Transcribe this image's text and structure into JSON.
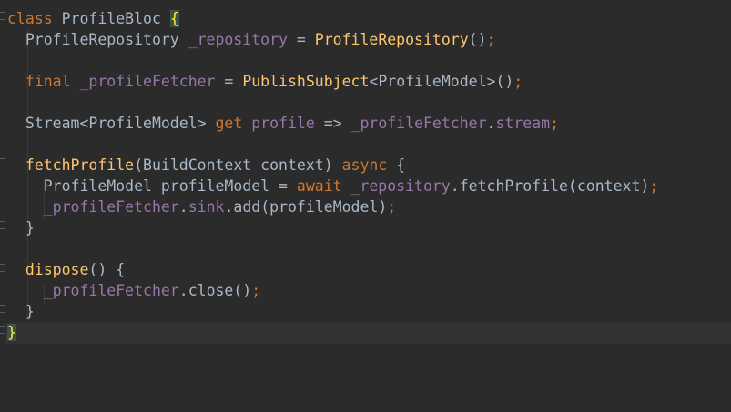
{
  "editor": {
    "lines": [
      [
        {
          "t": "class",
          "c": "kw"
        },
        {
          "t": " ProfileBloc ",
          "c": "id"
        },
        {
          "t": "{",
          "c": "brace-match"
        }
      ],
      [
        {
          "t": "  ProfileRepository ",
          "c": "id"
        },
        {
          "t": "_repository",
          "c": "fld"
        },
        {
          "t": " = ",
          "c": "id"
        },
        {
          "t": "ProfileRepository",
          "c": "fn"
        },
        {
          "t": "()",
          "c": "id"
        },
        {
          "t": ";",
          "c": "kw"
        }
      ],
      [],
      [
        {
          "t": "  ",
          "c": "id"
        },
        {
          "t": "final",
          "c": "kw"
        },
        {
          "t": " ",
          "c": "id"
        },
        {
          "t": "_profileFetcher",
          "c": "fld"
        },
        {
          "t": " = ",
          "c": "id"
        },
        {
          "t": "PublishSubject",
          "c": "fn"
        },
        {
          "t": "<ProfileModel>()",
          "c": "id"
        },
        {
          "t": ";",
          "c": "kw"
        }
      ],
      [],
      [
        {
          "t": "  Stream<ProfileModel> ",
          "c": "id"
        },
        {
          "t": "get",
          "c": "kw"
        },
        {
          "t": " ",
          "c": "id"
        },
        {
          "t": "profile",
          "c": "fld"
        },
        {
          "t": " => ",
          "c": "id"
        },
        {
          "t": "_profileFetcher",
          "c": "fld"
        },
        {
          "t": ".",
          "c": "id"
        },
        {
          "t": "stream",
          "c": "fld"
        },
        {
          "t": ";",
          "c": "kw"
        }
      ],
      [],
      [
        {
          "t": "  ",
          "c": "id"
        },
        {
          "t": "fetchProfile",
          "c": "fn"
        },
        {
          "t": "(BuildContext context) ",
          "c": "id"
        },
        {
          "t": "async",
          "c": "kw"
        },
        {
          "t": " {",
          "c": "id"
        }
      ],
      [
        {
          "t": "    ProfileModel profileModel = ",
          "c": "id"
        },
        {
          "t": "await",
          "c": "kw"
        },
        {
          "t": " ",
          "c": "id"
        },
        {
          "t": "_repository",
          "c": "fld"
        },
        {
          "t": ".fetchProfile(context)",
          "c": "id"
        },
        {
          "t": ";",
          "c": "kw"
        }
      ],
      [
        {
          "t": "    ",
          "c": "id"
        },
        {
          "t": "_profileFetcher",
          "c": "fld"
        },
        {
          "t": ".",
          "c": "id"
        },
        {
          "t": "sink",
          "c": "fld"
        },
        {
          "t": ".add(profileModel)",
          "c": "id"
        },
        {
          "t": ";",
          "c": "kw"
        }
      ],
      [
        {
          "t": "  }",
          "c": "id"
        }
      ],
      [],
      [
        {
          "t": "  ",
          "c": "id"
        },
        {
          "t": "dispose",
          "c": "fn"
        },
        {
          "t": "() {",
          "c": "id"
        }
      ],
      [
        {
          "t": "    ",
          "c": "id"
        },
        {
          "t": "_profileFetcher",
          "c": "fld"
        },
        {
          "t": ".close()",
          "c": "id"
        },
        {
          "t": ";",
          "c": "kw"
        }
      ],
      [
        {
          "t": "  }",
          "c": "id"
        }
      ],
      [
        {
          "t": "}",
          "c": "brace-match"
        }
      ]
    ]
  },
  "colors": {
    "background": "#2b2b2b",
    "keyword": "#cc7832",
    "function": "#ffc66d",
    "field": "#9876aa",
    "identifier": "#a9b7c6",
    "brace_match": "#ffef28",
    "caret_line": "#323232"
  }
}
